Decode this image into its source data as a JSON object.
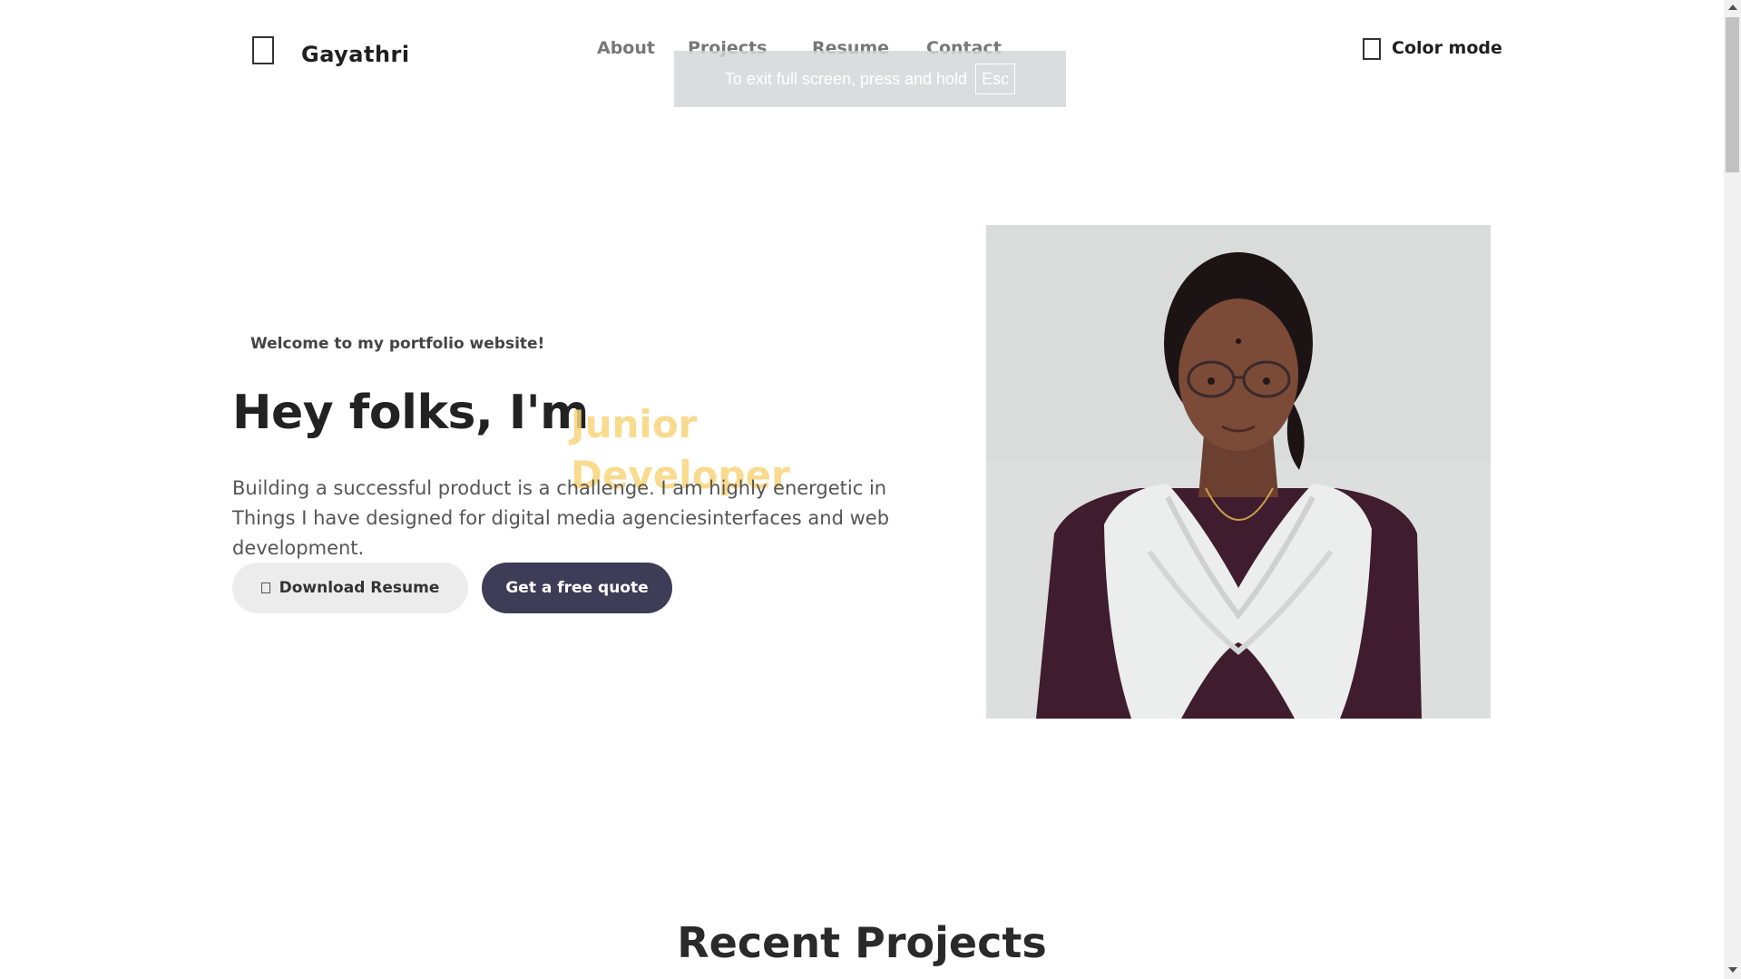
{
  "header": {
    "brand": "Gayathri",
    "nav": [
      {
        "label": "About"
      },
      {
        "label": "Projects"
      },
      {
        "label": "Resume"
      },
      {
        "label": "Contact"
      }
    ],
    "color_mode_label": "Color mode"
  },
  "fullscreen_toast": {
    "text": "To exit full screen, press and hold",
    "key": "Esc"
  },
  "hero": {
    "welcome": "Welcome to my portfolio website!",
    "title": "Hey folks, I'm",
    "role": "Junior Developer",
    "description": "Building a successful product is a challenge. I am highly energetic in Things I have designed for digital media agenciesinterfaces and web development.",
    "download_button": "Download Resume",
    "quote_button": "Get a free quote"
  },
  "projects": {
    "title": "Recent Projects"
  },
  "colors": {
    "accent_yellow": "#f9d57c",
    "button_dark": "#3f3c57",
    "button_light": "#ececec"
  },
  "icons": {
    "logo": "logo-icon",
    "color_mode": "checkbox-icon",
    "download": "download-icon"
  }
}
